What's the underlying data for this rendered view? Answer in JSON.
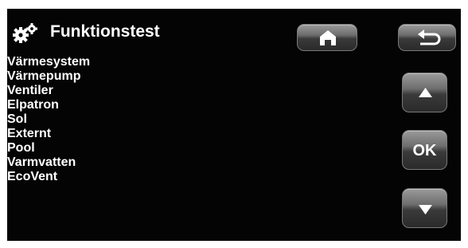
{
  "header": {
    "title": "Funktionstest",
    "icon": "gears-icon"
  },
  "menu": {
    "items": [
      {
        "label": "Värmesystem"
      },
      {
        "label": "Värmepump"
      },
      {
        "label": "Ventiler"
      },
      {
        "label": "Elpatron"
      },
      {
        "label": "Sol"
      },
      {
        "label": "Externt"
      },
      {
        "label": "Pool"
      },
      {
        "label": "Varmvatten"
      },
      {
        "label": "EcoVent"
      }
    ]
  },
  "buttons": {
    "home_icon": "home-icon",
    "back_icon": "back-arrow-icon",
    "up_icon": "up-arrow-icon",
    "ok_label": "OK",
    "down_icon": "down-arrow-icon"
  },
  "colors": {
    "background": "#040404",
    "text": "#ffffff",
    "button_top": "#9a9a9a",
    "button_bottom": "#2a2a2a"
  }
}
